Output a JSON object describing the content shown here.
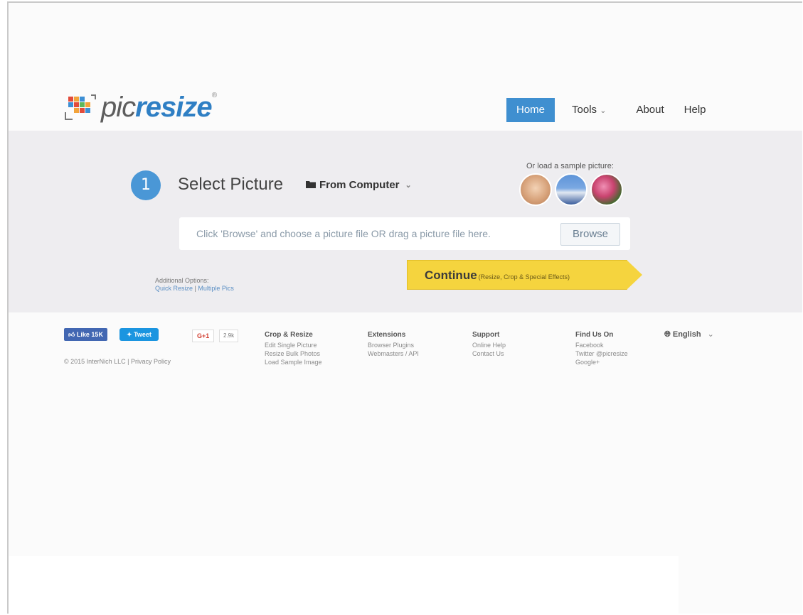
{
  "brand": {
    "name_plain": "pic",
    "name_accent": "resize",
    "reg_mark": "®"
  },
  "nav": {
    "home": "Home",
    "tools": "Tools",
    "tools_caret": "⌄",
    "about": "About",
    "help": "Help"
  },
  "step": {
    "number": "1",
    "title": "Select Picture",
    "source_label": "From Computer",
    "source_caret": "⌄",
    "sample_label": "Or load a sample picture:"
  },
  "dropzone": {
    "text": "Click 'Browse' and choose a picture file OR drag a picture file here.",
    "browse_label": "Browse"
  },
  "additional": {
    "label": "Additional Options:",
    "quick_resize": "Quick Resize",
    "separator": "|",
    "multiple_pics": "Multiple Pics"
  },
  "continue": {
    "label": "Continue",
    "sub": "(Resize, Crop & Special Effects)"
  },
  "footer": {
    "fb_like": "Like 15K",
    "tweet": "Tweet",
    "gplus": "G+1",
    "gplus_count": "2.9k",
    "copyright": "© 2015 InterNich LLC | Privacy Policy",
    "columns": [
      {
        "head": "Crop & Resize",
        "links": [
          "Edit Single Picture",
          "Resize Bulk Photos",
          "Load Sample Image"
        ]
      },
      {
        "head": "Extensions",
        "links": [
          "Browser Plugins",
          "Webmasters / API"
        ]
      },
      {
        "head": "Support",
        "links": [
          "Online Help",
          "Contact Us"
        ]
      },
      {
        "head": "Find Us On",
        "links": [
          "Facebook",
          "Twitter @picresize",
          "Google+"
        ]
      }
    ],
    "language": "English",
    "language_caret": "⌄"
  },
  "colors": {
    "accent": "#3f8fd0",
    "continue": "#f5d43e",
    "band": "#eeedf0"
  }
}
